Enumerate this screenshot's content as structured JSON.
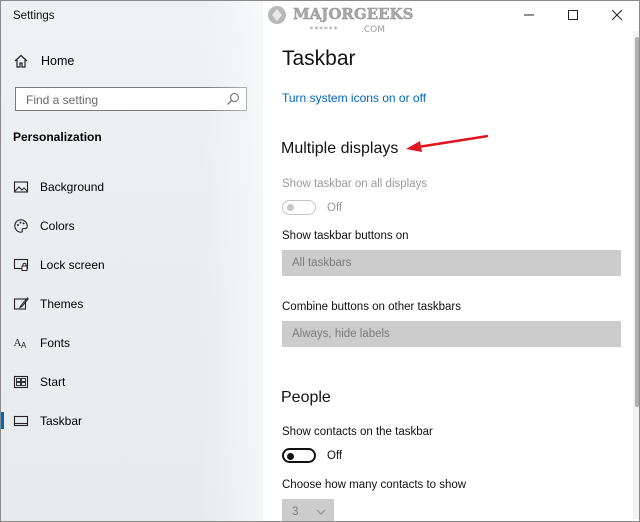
{
  "window": {
    "title": "Settings"
  },
  "sidebar": {
    "home_label": "Home",
    "search": {
      "placeholder": "Find a setting"
    },
    "section_title": "Personalization",
    "items": [
      {
        "label": "Background",
        "icon": "image-icon"
      },
      {
        "label": "Colors",
        "icon": "palette-icon"
      },
      {
        "label": "Lock screen",
        "icon": "lock-screen-icon"
      },
      {
        "label": "Themes",
        "icon": "themes-icon"
      },
      {
        "label": "Fonts",
        "icon": "fonts-icon"
      },
      {
        "label": "Start",
        "icon": "start-icon"
      },
      {
        "label": "Taskbar",
        "icon": "taskbar-icon",
        "active": true
      }
    ]
  },
  "main": {
    "watermark": {
      "brand": "MAJORGEEKS",
      "domain": ".COM",
      "stars": "******"
    },
    "title": "Taskbar",
    "link": "Turn system icons on or off",
    "multiple_displays": {
      "heading": "Multiple displays",
      "show_taskbar_label": "Show taskbar on all displays",
      "show_taskbar_state": "Off",
      "buttons_on_label": "Show taskbar buttons on",
      "buttons_on_value": "All taskbars",
      "combine_label": "Combine buttons on other taskbars",
      "combine_value": "Always, hide labels"
    },
    "people": {
      "heading": "People",
      "show_contacts_label": "Show contacts on the taskbar",
      "show_contacts_state": "Off",
      "contacts_count_label": "Choose how many contacts to show",
      "contacts_count_value": "3"
    }
  },
  "colors": {
    "accent": "#0067c0",
    "annotation_arrow": "#e0141e"
  }
}
